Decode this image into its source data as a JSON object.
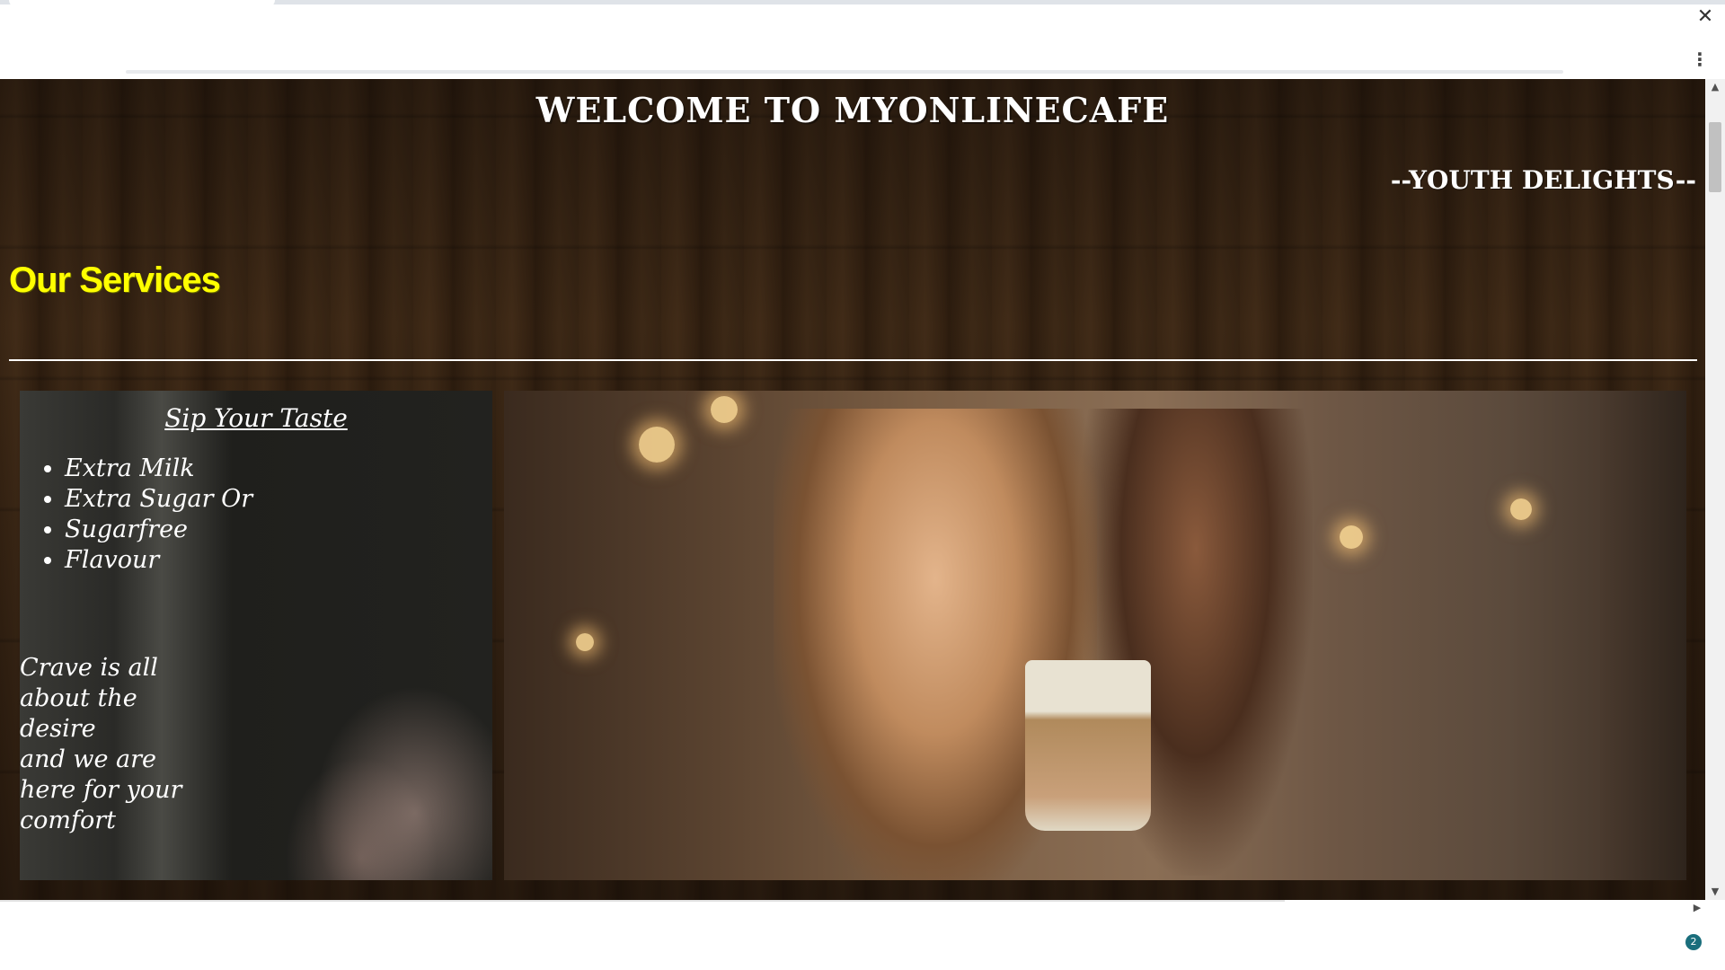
{
  "browser": {
    "close_glyph": "✕",
    "menu_glyph": "⋮",
    "badge_count": "2",
    "scroll_up_glyph": "▲",
    "scroll_down_glyph": "▼",
    "scroll_right_glyph": "▶"
  },
  "header": {
    "title": "WELCOME TO MYONLINECAFE",
    "tagline": "--YOUTH DELIGHTS--"
  },
  "services": {
    "heading": "Our Services",
    "card": {
      "title": "Sip Your Taste",
      "items": [
        "Extra Milk",
        "Extra Sugar Or",
        "Sugarfree",
        "Flavour"
      ],
      "text_lines": [
        "Crave is all about the desire",
        "and we are here for your comfort"
      ]
    }
  },
  "colors": {
    "heading_accent": "#ffff00",
    "badge": "#1a6e7c"
  }
}
